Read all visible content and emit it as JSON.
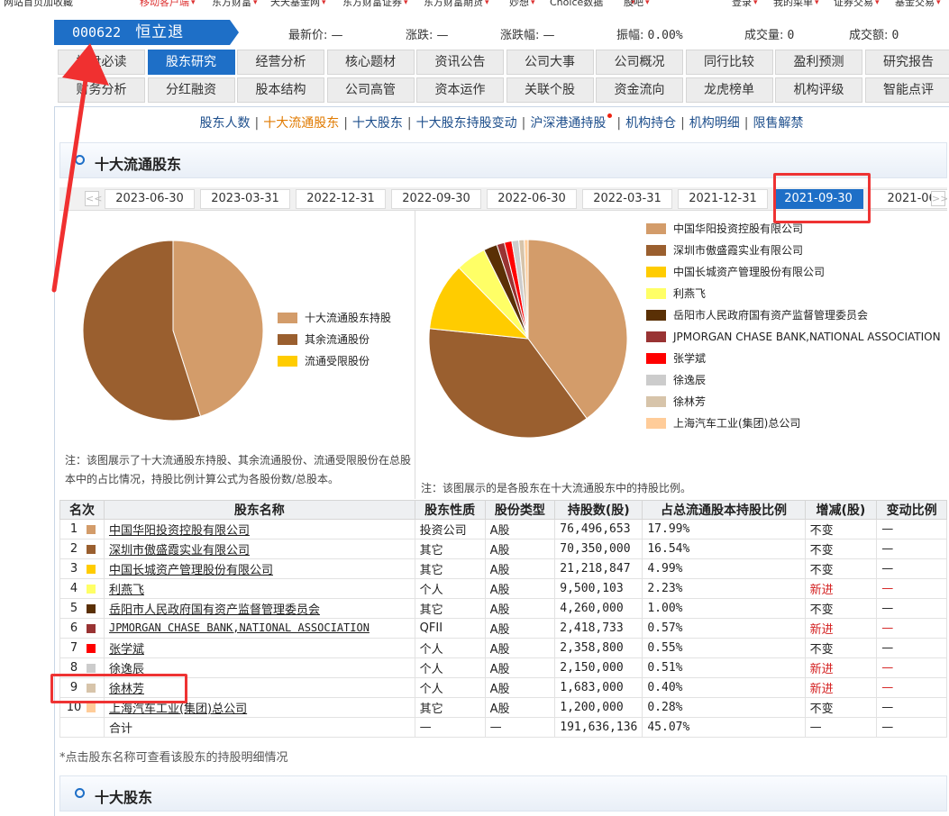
{
  "top_nav": {
    "items": [
      {
        "label": "网站首页",
        "red": false
      },
      {
        "label": "加收藏",
        "red": false
      },
      {
        "label": "移动客户端",
        "red": true
      },
      {
        "label": "东方财富",
        "red": false
      },
      {
        "label": "天天基金网",
        "red": false
      },
      {
        "label": "东方财富证券",
        "red": false
      },
      {
        "label": "东方财富期货",
        "red": false
      },
      {
        "label": "妙想",
        "red": false
      },
      {
        "label": "Choice数据",
        "red": false
      },
      {
        "label": "股吧",
        "red": false
      },
      {
        "label": "登录",
        "red": false
      },
      {
        "label": "我的菜单",
        "red": false
      },
      {
        "label": "证券交易",
        "red": false
      },
      {
        "label": "基金交易",
        "red": false
      }
    ]
  },
  "stock": {
    "code": "000622",
    "name": "恒立退",
    "latest_label": "最新价:",
    "latest": "—",
    "change_label": "涨跌:",
    "change": "—",
    "pct_label": "涨跌幅:",
    "pct": "—",
    "amplitude_label": "振幅:",
    "amplitude": "0.00%",
    "volume_label": "成交量:",
    "volume": "0",
    "turnover_label": "成交额:",
    "turnover": "0"
  },
  "tabs_row1": [
    "操盘必读",
    "股东研究",
    "经营分析",
    "核心题材",
    "资讯公告",
    "公司大事",
    "公司概况",
    "同行比较",
    "盈利预测",
    "研究报告"
  ],
  "tabs_row2": [
    "财务分析",
    "分红融资",
    "股本结构",
    "公司高管",
    "资本运作",
    "关联个股",
    "资金流向",
    "龙虎榜单",
    "机构评级",
    "智能点评"
  ],
  "tabs_row1_visible": [
    "操",
    "必读"
  ],
  "tabs_row2_visible": "分析",
  "active_tab": "股东研究",
  "sublinks": [
    "股东人数",
    "十大流通股东",
    "十大股东",
    "十大股东持股变动",
    "沪深港通持股",
    "机构持仓",
    "机构明细",
    "限售解禁"
  ],
  "active_sublink": "十大流通股东",
  "section1_title": "十大流通股东",
  "section2_title": "十大股东",
  "dates": [
    "2023-06-30",
    "2023-03-31",
    "2022-12-31",
    "2022-09-30",
    "2022-06-30",
    "2022-03-31",
    "2021-12-31",
    "2021-09-30",
    "2021-06-"
  ],
  "active_date": "2021-09-30",
  "arrows": {
    "prev": "<<",
    "next": ">>"
  },
  "left_chart": {
    "legend": [
      {
        "label": "十大流通股东持股",
        "color": "#d39c6a",
        "value": 45.07
      },
      {
        "label": "其余流通股份",
        "color": "#9a5f2f",
        "value": 54.93
      },
      {
        "label": "流通受限股份",
        "color": "#ffcc00",
        "value": 0
      }
    ],
    "note": "注：该图展示了十大流通股东持股、其余流通股份、流通受限股份在总股本中的占比情况，持股比例计算公式为各股份数/总股本。"
  },
  "right_chart": {
    "legend": [
      {
        "label": "中国华阳投资控股有限公司",
        "color": "#d39c6a"
      },
      {
        "label": "深圳市傲盛霞实业有限公司",
        "color": "#9a5f2f"
      },
      {
        "label": "中国长城资产管理股份有限公司",
        "color": "#ffcc00"
      },
      {
        "label": "利燕飞",
        "color": "#ffff66"
      },
      {
        "label": "岳阳市人民政府国有资产监督管理委员会",
        "color": "#5a3005"
      },
      {
        "label": "JPMORGAN CHASE BANK,NATIONAL ASSOCIATION",
        "color": "#993333"
      },
      {
        "label": "张学斌",
        "color": "#ff0000"
      },
      {
        "label": "徐逸辰",
        "color": "#cccccc"
      },
      {
        "label": "徐林芳",
        "color": "#d7c4aa"
      },
      {
        "label": "上海汽车工业(集团)总公司",
        "color": "#ffcc99"
      }
    ],
    "note": "注：该图展示的是各股东在十大流通股东中的持股比例。"
  },
  "table": {
    "headers": [
      "名次",
      "股东名称",
      "股东性质",
      "股份类型",
      "持股数(股)",
      "占总流通股本持股比例",
      "增减(股)",
      "变动比例"
    ],
    "rows": [
      {
        "rank": "1",
        "color": "#d39c6a",
        "name": "中国华阳投资控股有限公司",
        "nature": "投资公司",
        "type": "A股",
        "shares": "76,496,653",
        "ratio": "17.99%",
        "change": "不变",
        "change_red": false,
        "pct": "—"
      },
      {
        "rank": "2",
        "color": "#9a5f2f",
        "name": "深圳市傲盛霞实业有限公司",
        "nature": "其它",
        "type": "A股",
        "shares": "70,350,000",
        "ratio": "16.54%",
        "change": "不变",
        "change_red": false,
        "pct": "—"
      },
      {
        "rank": "3",
        "color": "#ffcc00",
        "name": "中国长城资产管理股份有限公司",
        "nature": "其它",
        "type": "A股",
        "shares": "21,218,847",
        "ratio": "4.99%",
        "change": "不变",
        "change_red": false,
        "pct": "—"
      },
      {
        "rank": "4",
        "color": "#ffff66",
        "name": "利燕飞",
        "nature": "个人",
        "type": "A股",
        "shares": "9,500,103",
        "ratio": "2.23%",
        "change": "新进",
        "change_red": true,
        "pct": "—"
      },
      {
        "rank": "5",
        "color": "#5a3005",
        "name": "岳阳市人民政府国有资产监督管理委员会",
        "nature": "其它",
        "type": "A股",
        "shares": "4,260,000",
        "ratio": "1.00%",
        "change": "不变",
        "change_red": false,
        "pct": "—"
      },
      {
        "rank": "6",
        "color": "#993333",
        "name": "JPMORGAN CHASE BANK,NATIONAL ASSOCIATION",
        "nature": "QFII",
        "type": "A股",
        "shares": "2,418,733",
        "ratio": "0.57%",
        "change": "新进",
        "change_red": true,
        "pct": "—"
      },
      {
        "rank": "7",
        "color": "#ff0000",
        "name": "张学斌",
        "nature": "个人",
        "type": "A股",
        "shares": "2,358,800",
        "ratio": "0.55%",
        "change": "不变",
        "change_red": false,
        "pct": "—"
      },
      {
        "rank": "8",
        "color": "#cccccc",
        "name": "徐逸辰",
        "nature": "个人",
        "type": "A股",
        "shares": "2,150,000",
        "ratio": "0.51%",
        "change": "新进",
        "change_red": true,
        "pct": "—"
      },
      {
        "rank": "9",
        "color": "#d7c4aa",
        "name": "徐林芳",
        "nature": "个人",
        "type": "A股",
        "shares": "1,683,000",
        "ratio": "0.40%",
        "change": "新进",
        "change_red": true,
        "pct": "—"
      },
      {
        "rank": "10",
        "color": "#ffcc99",
        "name": "上海汽车工业(集团)总公司",
        "nature": "其它",
        "type": "A股",
        "shares": "1,200,000",
        "ratio": "0.28%",
        "change": "不变",
        "change_red": false,
        "pct": "—"
      }
    ],
    "total": {
      "label": "合计",
      "nature": "—",
      "type": "—",
      "shares": "191,636,136",
      "ratio": "45.07%",
      "change": "—",
      "pct": "—"
    }
  },
  "footnote": "*点击股东名称可查看该股东的持股明细情况"
}
